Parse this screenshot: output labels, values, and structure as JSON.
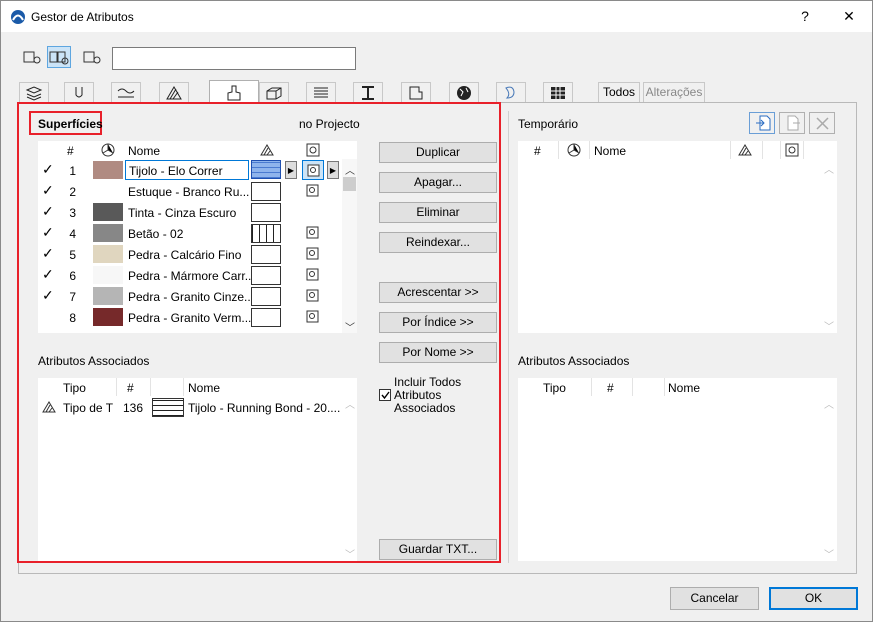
{
  "window": {
    "title": "Gestor de Atributos",
    "help": "?",
    "close": "✕"
  },
  "search": {
    "value": ""
  },
  "tabs": {
    "todos": "Todos",
    "alteracoes": "Alterações"
  },
  "left": {
    "section_label": "Superfícies",
    "project_label": "no Projecto",
    "columns": {
      "num": "#",
      "name": "Nome"
    },
    "rows": [
      {
        "check": "✓",
        "num": "1",
        "name": "Tijolo - Elo Correr",
        "color": "#b08b82"
      },
      {
        "check": "✓",
        "num": "2",
        "name": "Estuque - Branco Ru...",
        "color": "#ffffff"
      },
      {
        "check": "✓",
        "num": "3",
        "name": "Tinta - Cinza Escuro",
        "color": "#595959"
      },
      {
        "check": "✓",
        "num": "4",
        "name": "Betão - 02",
        "color": "#878787"
      },
      {
        "check": "✓",
        "num": "5",
        "name": "Pedra - Calcário Fino",
        "color": "#e0d6bf"
      },
      {
        "check": "✓",
        "num": "6",
        "name": "Pedra - Mármore Carr...",
        "color": "#f7f7f7"
      },
      {
        "check": "✓",
        "num": "7",
        "name": "Pedra - Granito Cinze...",
        "color": "#b5b5b5"
      },
      {
        "check": "",
        "num": "8",
        "name": "Pedra - Granito Verm...",
        "color": "#76292a"
      }
    ],
    "assoc_label": "Atributos Associados",
    "assoc_columns": {
      "tipo": "Tipo",
      "num": "#",
      "name": "Nome"
    },
    "assoc_rows": [
      {
        "tipo": "Tipo de T",
        "num": "136",
        "name": "Tijolo - Running Bond - 20...."
      }
    ]
  },
  "middle": {
    "duplicate": "Duplicar",
    "clear": "Apagar...",
    "delete": "Eliminar",
    "reindex": "Reindexar...",
    "append": "Acrescentar >>",
    "by_index": "Por Índice >>",
    "by_name": "Por Nome >>",
    "include_label": "Incluir Todos Atributos Associados",
    "save_txt": "Guardar TXT..."
  },
  "right": {
    "section_label": "Temporário",
    "columns": {
      "num": "#",
      "name": "Nome"
    },
    "assoc_label": "Atributos Associados",
    "assoc_columns": {
      "tipo": "Tipo",
      "num": "#",
      "name": "Nome"
    }
  },
  "footer": {
    "cancel": "Cancelar",
    "ok": "OK"
  },
  "colors": {
    "accent": "#0078d7",
    "highlight": "#e8202a",
    "selection": "#cce4f7"
  }
}
